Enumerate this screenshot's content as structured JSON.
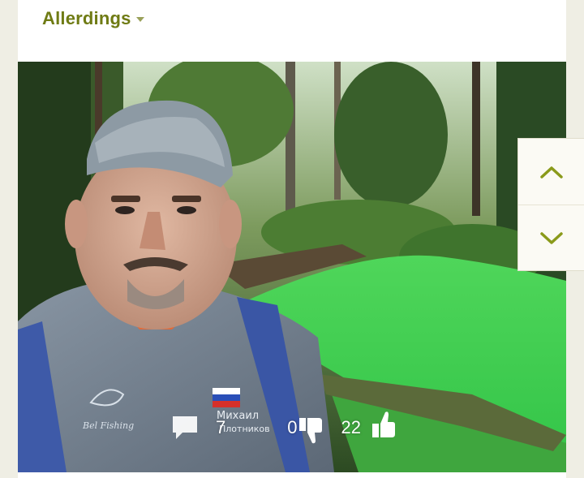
{
  "post": {
    "author": "Allerdings",
    "comments_count": "7",
    "dislikes_count": "0",
    "likes_count": "22"
  },
  "photo": {
    "jersey_text_line1": "Михаил",
    "jersey_text_line2": "Плотников",
    "jersey_logo_text": "Bel Fishing"
  },
  "icons": {
    "author_menu": "chevron-down-icon",
    "comments": "comment-icon",
    "dislike": "thumbs-down-icon",
    "like": "thumbs-up-icon",
    "scroll_up": "chevron-up-icon",
    "scroll_down": "chevron-down-icon"
  },
  "colors": {
    "author": "#6f7b14",
    "nav_arrow": "#8a9a1a",
    "background": "#efeee4"
  }
}
